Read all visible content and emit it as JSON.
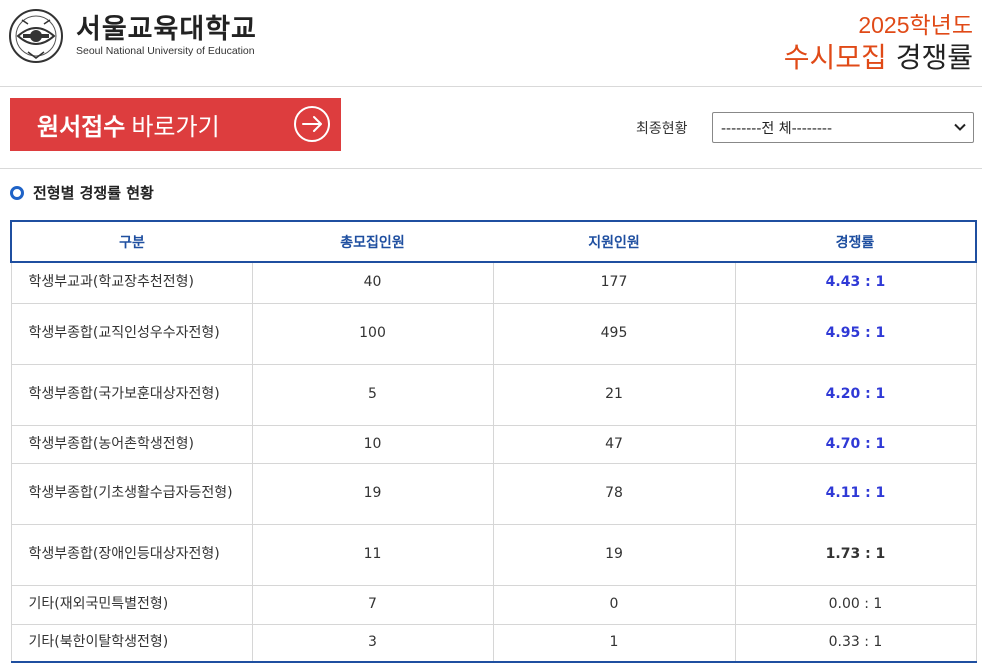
{
  "header": {
    "logo_kr": "서울교육대학교",
    "logo_en": "Seoul National University of Education",
    "title_year": "2025학년도",
    "title_prefix": "수시모집",
    "title_suffix": "경쟁률"
  },
  "toolbar": {
    "apply_strong": "원서접수",
    "apply_normal": "바로가기",
    "filter_label": "최종현황",
    "filter_value": "--------전 체--------"
  },
  "section": {
    "title": "전형별 경쟁률 현황"
  },
  "table": {
    "headers": [
      "구분",
      "총모집인원",
      "지원인원",
      "경쟁률"
    ],
    "rows": [
      {
        "name": "학생부교과(학교장추천전형)",
        "quota": "40",
        "applicants": "177",
        "rate": "4.43 : 1"
      },
      {
        "name": "학생부종합(교직인성우수자전형)",
        "quota": "100",
        "applicants": "495",
        "rate": "4.95 : 1"
      },
      {
        "name": "학생부종합(국가보훈대상자전형)",
        "quota": "5",
        "applicants": "21",
        "rate": "4.20 : 1"
      },
      {
        "name": "학생부종합(농어촌학생전형)",
        "quota": "10",
        "applicants": "47",
        "rate": "4.70 : 1"
      },
      {
        "name": "학생부종합(기초생활수급자등전형)",
        "quota": "19",
        "applicants": "78",
        "rate": "4.11 : 1"
      },
      {
        "name": "학생부종합(장애인등대상자전형)",
        "quota": "11",
        "applicants": "19",
        "rate": "1.73 : 1"
      },
      {
        "name": "기타(재외국민특별전형)",
        "quota": "7",
        "applicants": "0",
        "rate": "0.00 : 1"
      },
      {
        "name": "기타(북한이탈학생전형)",
        "quota": "3",
        "applicants": "1",
        "rate": "0.33 : 1"
      }
    ]
  },
  "colors": {
    "accent_orange": "#e04a17",
    "apply_red": "#dd3d3e",
    "table_blue": "#1f4fa0",
    "rate_blue": "#2f39d6"
  }
}
